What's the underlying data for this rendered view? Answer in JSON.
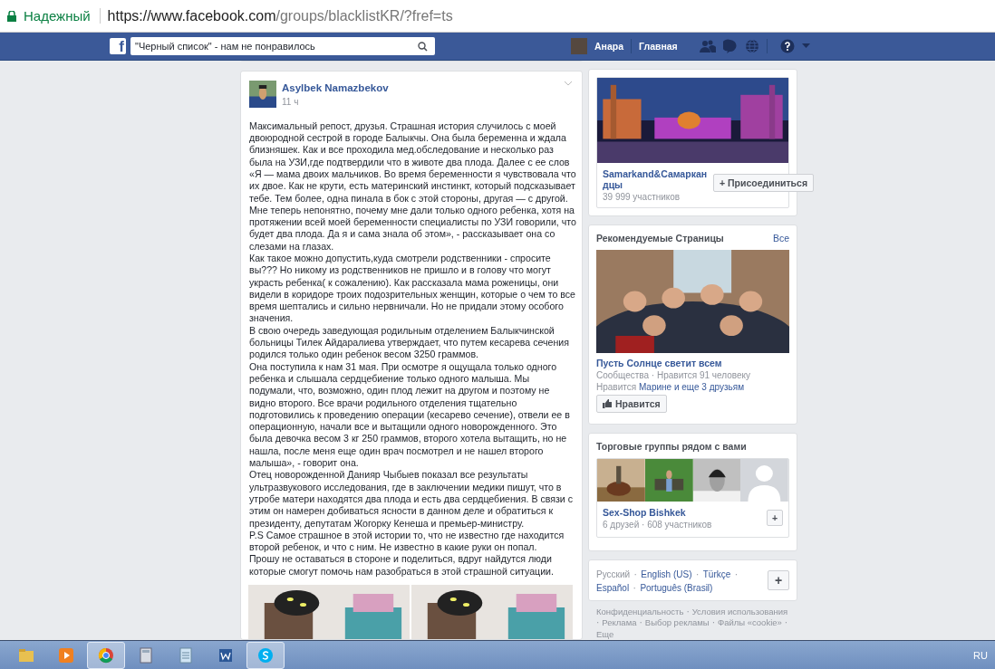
{
  "address_bar": {
    "security": "Надежный",
    "url_host": "https://www.facebook.com",
    "url_path": "/groups/blacklistKR/?fref=ts"
  },
  "top_bar": {
    "logo": "f",
    "search": {
      "value": "\"Черный список\" - нам не понравилось"
    },
    "user": "Анара",
    "home": "Главная"
  },
  "post": {
    "author": "Asylbek Namazbekov",
    "time": "11 ч",
    "paragraphs": [
      "Максимальный репост, друзья. Страшная история случилось с моей двоюродной сестрой в городе Балыкчы. Она была беременна и ждала близняшек. Как и все проходила мед.обследование и несколько раз была на УЗИ,где подтвердили что в животе два плода. Далее с ее слов «Я — мама двоих мальчиков. Во время беременности я чувствовала что их двое. Как не крути, есть материнский инстинкт, который подсказывает тебе. Тем более, одна пинала в бок с этой стороны, другая — с другой. Мне теперь непонятно, почему мне дали только одного ребенка, хотя на протяжении всей моей беременности специалисты по УЗИ говорили, что будет два плода. Да я и сама знала об этом», - рассказывает она со слезами на глазах.",
      "Как такое можно допустить,куда смотрели родственники - спросите вы??? Но никому из родственников не пришло и в голову что могут украсть ребенка( к сожалению). Как рассказала мама роженицы, они видели в коридоре троих подозрительных женщин, которые о чем то все время шептались и сильно нервничали. Но не придали этому особого значения.",
      "В свою очередь заведующая родильным отделением Балыкчинской больницы Тилек Айдаралиева утверждает, что путем кесарева сечения родился только один ребенок весом 3250 граммов.",
      "Она поступила к нам 31 мая. При осмотре я ощущала только одного ребенка и слышала сердцебиение только одного малыша. Мы подумали, что, возможно, один плод лежит на другом и поэтому не видно второго. Все врачи родильного отделения тщательно подготовились к проведению операции (кесарево сечение), отвели ее в операционную, начали все и вытащили одного новорожденного. Это была девочка весом 3 кг 250 граммов, второго хотела вытащить, но не нашла, после меня еще один врач посмотрел и не нашел второго малыша», - говорит она.",
      "Отец новорожденной Данияр Чыбыев показал все результаты ультразвукового исследования, где в заключении медики пишут, что в утробе матери находятся два плода и есть два сердцебиения. В связи с этим он намерен добиваться ясности в данном деле и обратиться к президенту, депутатам Жогорку Кенеша и премьер-министру.",
      "P.S Самое страшное в этой истории то, что не известно где находится второй ребенок, и что с ним. Не известно в какие руки он попал.",
      "Прошу не оставаться в стороне и поделиться, вдруг найдутся люди которые смогут помочь нам разобраться в этой страшной ситуации."
    ]
  },
  "group_suggestion": {
    "name": "Samarkand&Самаркандцы",
    "members": "39 999 участников",
    "join": "+ Присоединиться"
  },
  "recommended_pages": {
    "title": "Рекомендуемые Страницы",
    "all": "Все",
    "page_name": "Пусть Солнце светит всем",
    "meta": "Сообщества · Нравится 91 человеку",
    "liked_prefix": "Нравится ",
    "liked_link": "Марине и еще 3 друзьям",
    "like_button": "Нравится"
  },
  "sale_groups": {
    "title": "Торговые группы рядом с вами",
    "name": "Sex-Shop Bishkek",
    "meta": "6 друзей · 608 участников",
    "add": "+"
  },
  "languages": {
    "separator": "·",
    "items": [
      {
        "label": "Русский",
        "selected": true
      },
      {
        "label": "English (US)",
        "selected": false
      },
      {
        "label": "Türkçe",
        "selected": false
      },
      {
        "label": "Español",
        "selected": false
      },
      {
        "label": "Português (Brasil)",
        "selected": false
      }
    ],
    "add": "+"
  },
  "footer_separator": "·",
  "footer_links": [
    "Конфиденциальность",
    "Условия использования",
    "Реклама",
    "Выбор рекламы",
    "Файлы «cookie»",
    "Еще"
  ],
  "taskbar": {
    "apps": [
      {
        "kind": "folder",
        "selected": false
      },
      {
        "kind": "player",
        "selected": false
      },
      {
        "kind": "browser",
        "selected": true
      },
      {
        "kind": "calculator",
        "selected": false
      },
      {
        "kind": "notepad",
        "selected": false
      },
      {
        "kind": "word",
        "selected": false
      },
      {
        "kind": "skype",
        "selected": true
      }
    ],
    "language": "RU"
  }
}
